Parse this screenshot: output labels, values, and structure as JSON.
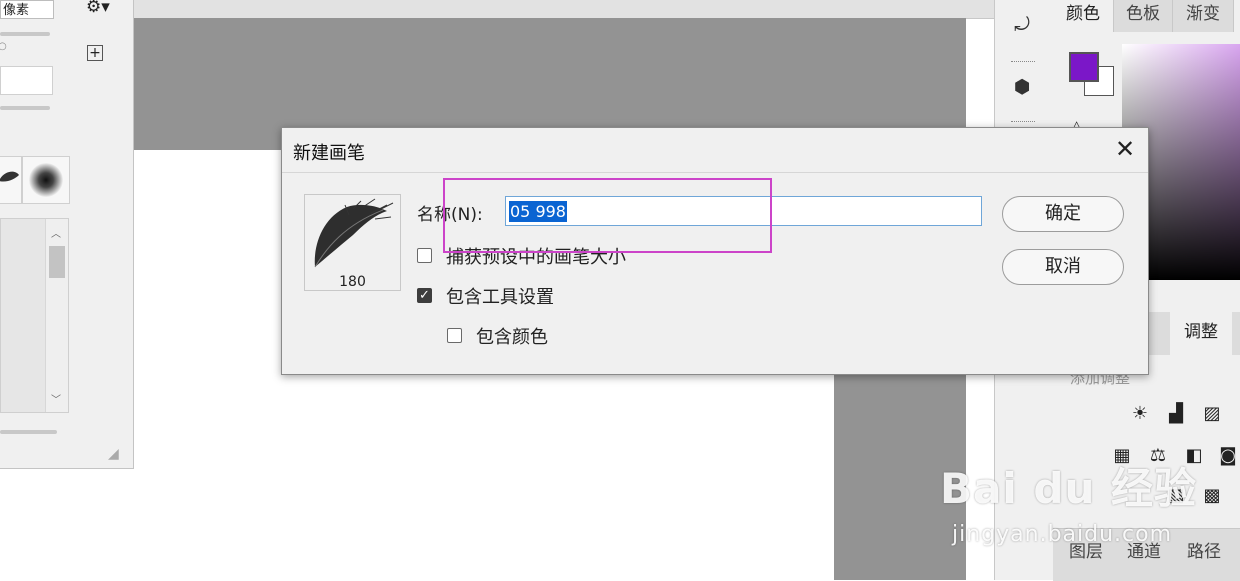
{
  "left_panel": {
    "unit_value": "像素",
    "gear_icon": "gear-icon",
    "add_icon": "plus-square-icon"
  },
  "dialog": {
    "title": "新建画笔",
    "close_icon": "close-icon",
    "preview_size": "180",
    "name_label": "名称(N):",
    "name_value": "05 998",
    "capture_size_label": "捕获预设中的画笔大小",
    "capture_size_checked": false,
    "include_tool_settings_label": "包含工具设置",
    "include_tool_settings_checked": true,
    "include_color_label": "包含颜色",
    "include_color_checked": false,
    "ok_label": "确定",
    "cancel_label": "取消"
  },
  "annotation": {
    "color": "#cc44c9"
  },
  "color_panel": {
    "tabs": [
      "颜色",
      "色板",
      "渐变"
    ],
    "foreground_color": "#7b17c8",
    "background_color": "#ffffff"
  },
  "adjustments_panel": {
    "tab": "调整",
    "add_label": "添加调整"
  },
  "layers_panel": {
    "tabs": [
      "图层",
      "通道",
      "路径"
    ]
  },
  "watermark": {
    "brand": "Bai du 经验",
    "url": "jingyan.baidu.com"
  }
}
